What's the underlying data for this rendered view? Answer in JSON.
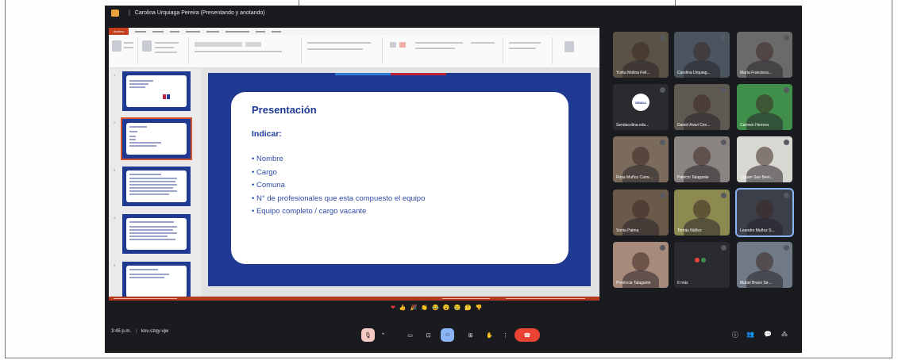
{
  "window": {
    "title": "Carolina Urquiaga Pereira (Presentando y anotando)"
  },
  "powerpoint": {
    "file_tab": "Archivo",
    "slide": {
      "title": "Presentación",
      "subtitle": "Indicar:",
      "bullets": [
        "Nombre",
        "Cargo",
        "Comuna",
        "N° de profesionales que esta compuesto el equipo",
        "Equipo completo / cargo vacante"
      ]
    }
  },
  "participants": [
    {
      "name": "Yurka Molina Fell...",
      "bg": "#5b5246"
    },
    {
      "name": "Carolina Urquiag...",
      "bg": "#4a5560"
    },
    {
      "name": "María Francisca...",
      "bg": "#6a6a6a"
    },
    {
      "name": "Sendacolina edu...",
      "bg": "#2a2b2f",
      "logo": "SENDA"
    },
    {
      "name": "Daniel Aravi Con...",
      "bg": "#5e5a52"
    },
    {
      "name": "Carmen Herrera",
      "bg": "#3f8f4a"
    },
    {
      "name": "Rosa Muñoz Carre...",
      "bg": "#7a6b5c"
    },
    {
      "name": "Patricio Talagante",
      "bg": "#8a8480"
    },
    {
      "name": "Cosam San Bern...",
      "bg": "#d9d7d2"
    },
    {
      "name": "Sonia Palma",
      "bg": "#6b5a4a"
    },
    {
      "name": "Tomás Núñez",
      "bg": "#8c8a50"
    },
    {
      "name": "Leandro Muñoz S...",
      "bg": "#3a3f4a"
    },
    {
      "name": "Provincia Talagante",
      "bg": "#a88a7a"
    },
    {
      "name": "6 más",
      "bg": "#2a2b2f",
      "more": true
    },
    {
      "name": "Mabel Bravo Se...",
      "bg": "#6f7a86"
    }
  ],
  "meeting": {
    "time": "3:45 p.m.",
    "code": "knv-czqy-vjw"
  },
  "colors": {
    "accent": "#1f3a93",
    "end_call": "#ea4335",
    "active_control": "#8ab4f8"
  }
}
